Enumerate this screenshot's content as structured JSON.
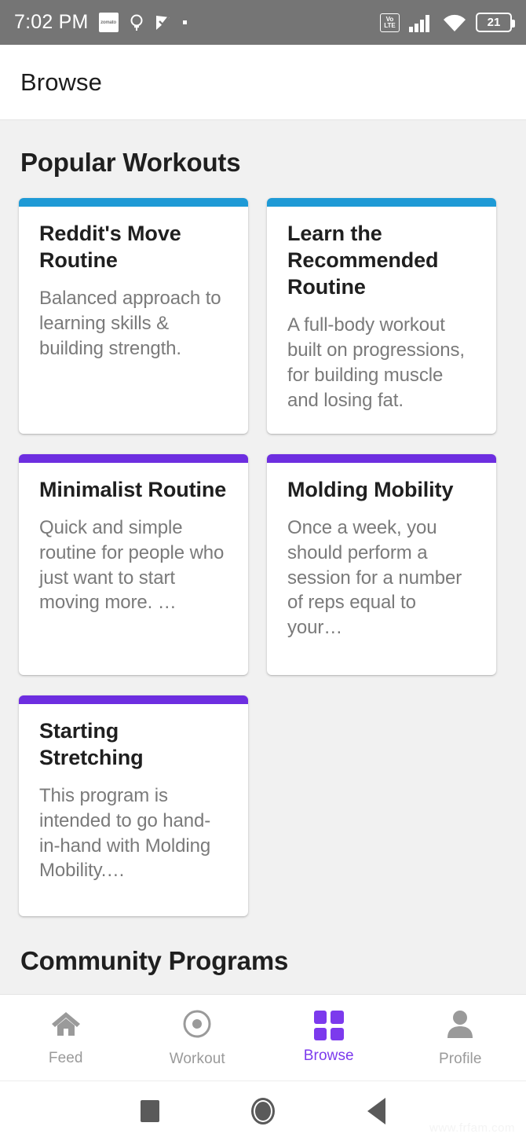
{
  "status_bar": {
    "time": "7:02 PM",
    "battery_level": "21",
    "network_label_top": "Vo",
    "network_label_bottom": "LTE",
    "app_icon_label": "zomato",
    "icons": [
      "zomato-icon",
      "ring-icon",
      "check-flag-icon",
      "dot-icon",
      "volte-icon",
      "signal-icon",
      "wifi-icon",
      "battery-icon"
    ]
  },
  "app_bar": {
    "title": "Browse"
  },
  "sections": {
    "popular": {
      "title": "Popular Workouts",
      "cards": [
        {
          "title": "Reddit's Move Routine",
          "description": "Balanced approach to learning skills & building strength.",
          "accent": "#1e9ad6"
        },
        {
          "title": "Learn the Recommended Routine",
          "description": "A full-body workout built on progressions, for building muscle and losing fat.",
          "accent": "#1e9ad6"
        },
        {
          "title": "Minimalist Routine",
          "description": "Quick and simple routine for people who just want to start moving more. …",
          "accent": "#6d2ee0"
        },
        {
          "title": "Molding Mobility",
          "description": "Once a week, you should perform a session for a number of reps equal to your…",
          "accent": "#6d2ee0"
        },
        {
          "title": "Starting Stretching",
          "description": "This program is intended to go hand-in-hand with Molding Mobility.…",
          "accent": "#6d2ee0"
        }
      ]
    },
    "community": {
      "title": "Community Programs"
    }
  },
  "bottom_nav": {
    "active": "Browse",
    "accent_color": "#7c3aed",
    "items": [
      {
        "label": "Feed",
        "icon": "home-icon"
      },
      {
        "label": "Workout",
        "icon": "target-circle-icon"
      },
      {
        "label": "Browse",
        "icon": "grid-icon"
      },
      {
        "label": "Profile",
        "icon": "person-icon"
      }
    ]
  },
  "android_nav": {
    "items": [
      {
        "icon": "recents-square-icon"
      },
      {
        "icon": "home-circle-icon"
      },
      {
        "icon": "back-triangle-icon"
      }
    ]
  },
  "watermark": "www.frfam.com"
}
